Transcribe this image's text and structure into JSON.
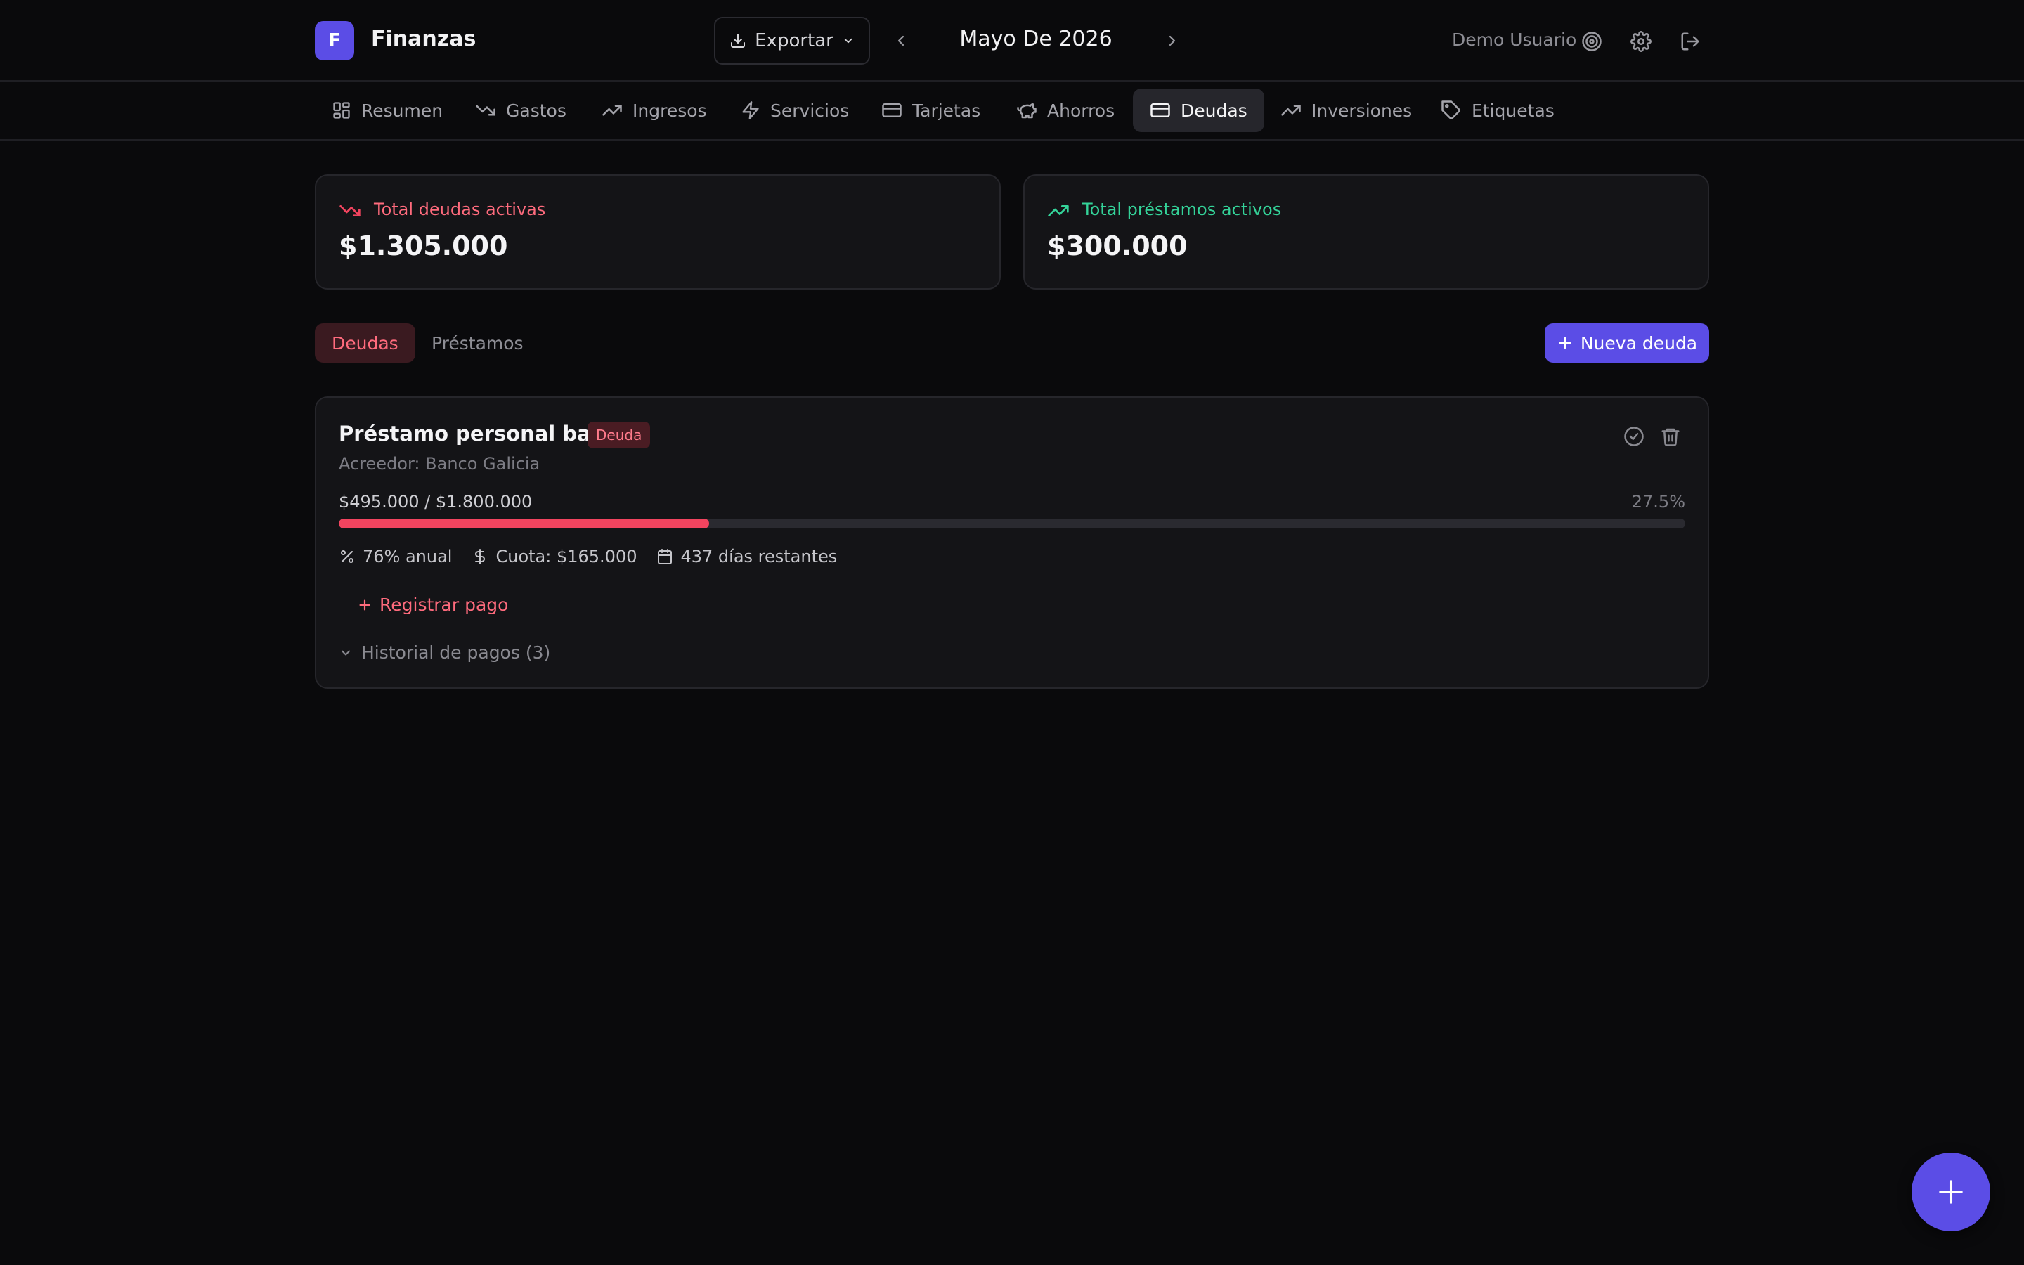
{
  "header": {
    "logo_letter": "F",
    "app_title": "Finanzas",
    "export_label": "Exportar",
    "month": "Mayo De 2026",
    "user_name": "Demo Usuario"
  },
  "nav": {
    "tabs": [
      {
        "label": "Resumen",
        "icon": "grid-icon"
      },
      {
        "label": "Gastos",
        "icon": "trending-down-icon"
      },
      {
        "label": "Ingresos",
        "icon": "trending-up-icon"
      },
      {
        "label": "Servicios",
        "icon": "zap-icon"
      },
      {
        "label": "Tarjetas",
        "icon": "credit-card-icon"
      },
      {
        "label": "Ahorros",
        "icon": "piggy-bank-icon"
      },
      {
        "label": "Deudas",
        "icon": "wallet-card-icon"
      },
      {
        "label": "Inversiones",
        "icon": "trending-up-icon"
      },
      {
        "label": "Etiquetas",
        "icon": "tag-icon"
      }
    ],
    "active": "Deudas"
  },
  "summary": {
    "debts": {
      "label": "Total deudas activas",
      "value": "$1.305.000",
      "color": "#f2445f"
    },
    "loans": {
      "label": "Total préstamos activos",
      "value": "$300.000",
      "color": "#34d399"
    }
  },
  "segment": {
    "tabs": [
      "Deudas",
      "Préstamos"
    ],
    "active": "Deudas",
    "new_button": "Nueva deuda"
  },
  "debt_card": {
    "name": "Préstamo personal banco",
    "badge": "Deuda",
    "creditor": "Acreedor: Banco Galicia",
    "amount": "$495.000 / $1.800.000",
    "percent_text": "27.5%",
    "progress": 0.275,
    "rate": "76% anual",
    "installment": "Cuota: $165.000",
    "days_left": "437 días restantes",
    "register_label": "Registrar pago",
    "history_label": "Historial de pagos (3)"
  },
  "colors": {
    "accent": "#5b4de6",
    "debt_red": "#f2445f",
    "loan_green": "#34d399",
    "background": "#0a0a0c"
  }
}
